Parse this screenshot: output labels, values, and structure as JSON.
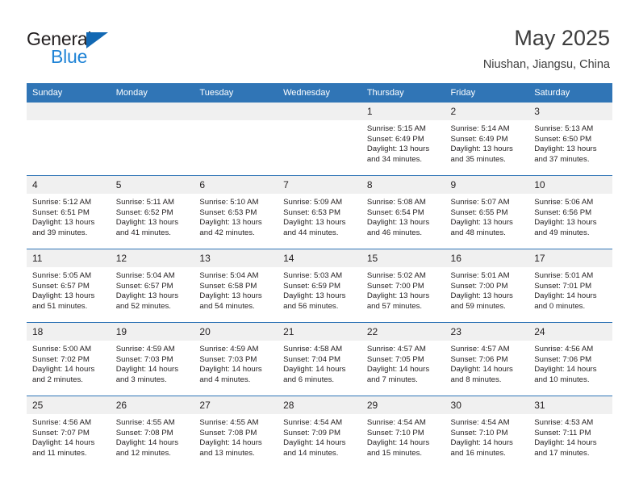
{
  "brand": {
    "line1": "General",
    "line2": "Blue",
    "triangle_color": "#1268b3",
    "blue_color": "#1f83d6"
  },
  "header": {
    "title": "May 2025",
    "subtitle": "Niushan, Jiangsu, China"
  },
  "theme": {
    "header_bg": "#3075b6",
    "daynum_bg": "#f0f0f0",
    "row_divider": "#3075b6",
    "text": "#231f20"
  },
  "calendar": {
    "weekday_headers": [
      "Sunday",
      "Monday",
      "Tuesday",
      "Wednesday",
      "Thursday",
      "Friday",
      "Saturday"
    ],
    "labels": {
      "sunrise": "Sunrise:",
      "sunset": "Sunset:",
      "daylight": "Daylight:"
    },
    "weeks": [
      [
        {
          "day": "",
          "empty": true
        },
        {
          "day": "",
          "empty": true
        },
        {
          "day": "",
          "empty": true
        },
        {
          "day": "",
          "empty": true
        },
        {
          "day": "1",
          "sunrise": "Sunrise: 5:15 AM",
          "sunset": "Sunset: 6:49 PM",
          "daylight_1": "Daylight: 13 hours",
          "daylight_2": "and 34 minutes."
        },
        {
          "day": "2",
          "sunrise": "Sunrise: 5:14 AM",
          "sunset": "Sunset: 6:49 PM",
          "daylight_1": "Daylight: 13 hours",
          "daylight_2": "and 35 minutes."
        },
        {
          "day": "3",
          "sunrise": "Sunrise: 5:13 AM",
          "sunset": "Sunset: 6:50 PM",
          "daylight_1": "Daylight: 13 hours",
          "daylight_2": "and 37 minutes."
        }
      ],
      [
        {
          "day": "4",
          "sunrise": "Sunrise: 5:12 AM",
          "sunset": "Sunset: 6:51 PM",
          "daylight_1": "Daylight: 13 hours",
          "daylight_2": "and 39 minutes."
        },
        {
          "day": "5",
          "sunrise": "Sunrise: 5:11 AM",
          "sunset": "Sunset: 6:52 PM",
          "daylight_1": "Daylight: 13 hours",
          "daylight_2": "and 41 minutes."
        },
        {
          "day": "6",
          "sunrise": "Sunrise: 5:10 AM",
          "sunset": "Sunset: 6:53 PM",
          "daylight_1": "Daylight: 13 hours",
          "daylight_2": "and 42 minutes."
        },
        {
          "day": "7",
          "sunrise": "Sunrise: 5:09 AM",
          "sunset": "Sunset: 6:53 PM",
          "daylight_1": "Daylight: 13 hours",
          "daylight_2": "and 44 minutes."
        },
        {
          "day": "8",
          "sunrise": "Sunrise: 5:08 AM",
          "sunset": "Sunset: 6:54 PM",
          "daylight_1": "Daylight: 13 hours",
          "daylight_2": "and 46 minutes."
        },
        {
          "day": "9",
          "sunrise": "Sunrise: 5:07 AM",
          "sunset": "Sunset: 6:55 PM",
          "daylight_1": "Daylight: 13 hours",
          "daylight_2": "and 48 minutes."
        },
        {
          "day": "10",
          "sunrise": "Sunrise: 5:06 AM",
          "sunset": "Sunset: 6:56 PM",
          "daylight_1": "Daylight: 13 hours",
          "daylight_2": "and 49 minutes."
        }
      ],
      [
        {
          "day": "11",
          "sunrise": "Sunrise: 5:05 AM",
          "sunset": "Sunset: 6:57 PM",
          "daylight_1": "Daylight: 13 hours",
          "daylight_2": "and 51 minutes."
        },
        {
          "day": "12",
          "sunrise": "Sunrise: 5:04 AM",
          "sunset": "Sunset: 6:57 PM",
          "daylight_1": "Daylight: 13 hours",
          "daylight_2": "and 52 minutes."
        },
        {
          "day": "13",
          "sunrise": "Sunrise: 5:04 AM",
          "sunset": "Sunset: 6:58 PM",
          "daylight_1": "Daylight: 13 hours",
          "daylight_2": "and 54 minutes."
        },
        {
          "day": "14",
          "sunrise": "Sunrise: 5:03 AM",
          "sunset": "Sunset: 6:59 PM",
          "daylight_1": "Daylight: 13 hours",
          "daylight_2": "and 56 minutes."
        },
        {
          "day": "15",
          "sunrise": "Sunrise: 5:02 AM",
          "sunset": "Sunset: 7:00 PM",
          "daylight_1": "Daylight: 13 hours",
          "daylight_2": "and 57 minutes."
        },
        {
          "day": "16",
          "sunrise": "Sunrise: 5:01 AM",
          "sunset": "Sunset: 7:00 PM",
          "daylight_1": "Daylight: 13 hours",
          "daylight_2": "and 59 minutes."
        },
        {
          "day": "17",
          "sunrise": "Sunrise: 5:01 AM",
          "sunset": "Sunset: 7:01 PM",
          "daylight_1": "Daylight: 14 hours",
          "daylight_2": "and 0 minutes."
        }
      ],
      [
        {
          "day": "18",
          "sunrise": "Sunrise: 5:00 AM",
          "sunset": "Sunset: 7:02 PM",
          "daylight_1": "Daylight: 14 hours",
          "daylight_2": "and 2 minutes."
        },
        {
          "day": "19",
          "sunrise": "Sunrise: 4:59 AM",
          "sunset": "Sunset: 7:03 PM",
          "daylight_1": "Daylight: 14 hours",
          "daylight_2": "and 3 minutes."
        },
        {
          "day": "20",
          "sunrise": "Sunrise: 4:59 AM",
          "sunset": "Sunset: 7:03 PM",
          "daylight_1": "Daylight: 14 hours",
          "daylight_2": "and 4 minutes."
        },
        {
          "day": "21",
          "sunrise": "Sunrise: 4:58 AM",
          "sunset": "Sunset: 7:04 PM",
          "daylight_1": "Daylight: 14 hours",
          "daylight_2": "and 6 minutes."
        },
        {
          "day": "22",
          "sunrise": "Sunrise: 4:57 AM",
          "sunset": "Sunset: 7:05 PM",
          "daylight_1": "Daylight: 14 hours",
          "daylight_2": "and 7 minutes."
        },
        {
          "day": "23",
          "sunrise": "Sunrise: 4:57 AM",
          "sunset": "Sunset: 7:06 PM",
          "daylight_1": "Daylight: 14 hours",
          "daylight_2": "and 8 minutes."
        },
        {
          "day": "24",
          "sunrise": "Sunrise: 4:56 AM",
          "sunset": "Sunset: 7:06 PM",
          "daylight_1": "Daylight: 14 hours",
          "daylight_2": "and 10 minutes."
        }
      ],
      [
        {
          "day": "25",
          "sunrise": "Sunrise: 4:56 AM",
          "sunset": "Sunset: 7:07 PM",
          "daylight_1": "Daylight: 14 hours",
          "daylight_2": "and 11 minutes."
        },
        {
          "day": "26",
          "sunrise": "Sunrise: 4:55 AM",
          "sunset": "Sunset: 7:08 PM",
          "daylight_1": "Daylight: 14 hours",
          "daylight_2": "and 12 minutes."
        },
        {
          "day": "27",
          "sunrise": "Sunrise: 4:55 AM",
          "sunset": "Sunset: 7:08 PM",
          "daylight_1": "Daylight: 14 hours",
          "daylight_2": "and 13 minutes."
        },
        {
          "day": "28",
          "sunrise": "Sunrise: 4:54 AM",
          "sunset": "Sunset: 7:09 PM",
          "daylight_1": "Daylight: 14 hours",
          "daylight_2": "and 14 minutes."
        },
        {
          "day": "29",
          "sunrise": "Sunrise: 4:54 AM",
          "sunset": "Sunset: 7:10 PM",
          "daylight_1": "Daylight: 14 hours",
          "daylight_2": "and 15 minutes."
        },
        {
          "day": "30",
          "sunrise": "Sunrise: 4:54 AM",
          "sunset": "Sunset: 7:10 PM",
          "daylight_1": "Daylight: 14 hours",
          "daylight_2": "and 16 minutes."
        },
        {
          "day": "31",
          "sunrise": "Sunrise: 4:53 AM",
          "sunset": "Sunset: 7:11 PM",
          "daylight_1": "Daylight: 14 hours",
          "daylight_2": "and 17 minutes."
        }
      ]
    ]
  }
}
